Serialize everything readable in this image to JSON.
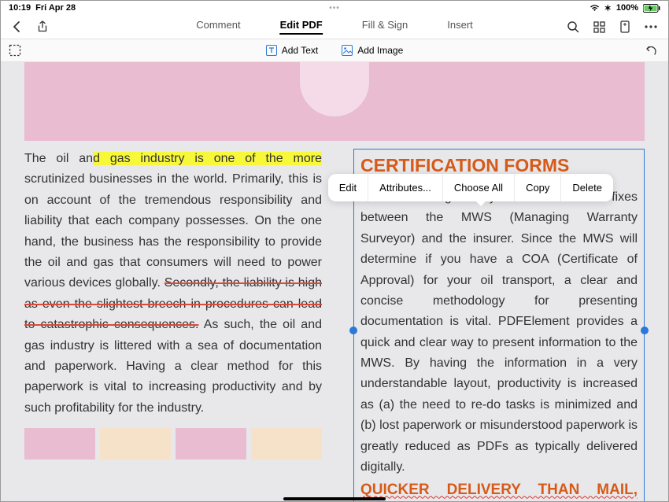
{
  "status": {
    "time": "10:19",
    "date": "Fri Apr 28",
    "battery": "100%"
  },
  "tabs": {
    "comment": "Comment",
    "edit": "Edit PDF",
    "fill": "Fill & Sign",
    "insert": "Insert"
  },
  "tools": {
    "addText": "Add Text",
    "addImage": "Add Image"
  },
  "contextMenu": [
    "Edit",
    "Attributes...",
    "Choose All",
    "Copy",
    "Delete"
  ],
  "leftCol": {
    "pre": "The oil an",
    "hl": "d gas industry is one of the more",
    "mid1": " scrutinized businesses in the world. Primarily, this is on account of the tremendous responsibility and liability that each company possesses. On the one hand, the business has the responsibility to provide the oil and gas that consumers will need to power various devices globally. ",
    "strike": "Secondly, the liability is high as even the slightest breech in procedures can lead to catastrophic consequences.",
    "mid2": " As such, the oil and gas industry is littered with a sea of documentation and paperwork. Having a clear method for this paperwork is vital to increasing productivity and by such profitability for the industry."
  },
  "rightCol": {
    "heading1": "CERTIFICATION FORMS",
    "body": "Certification is generally a back and forth of fixes between the MWS (Managing Warranty Surveyor) and the insurer. Since the MWS will determine if you have a COA (Certificate of Approval) for your oil transport, a clear and concise methodology for presenting documentation is vital. PDFElement provides a quick and clear way to present information to the MWS. By having the information in a very understandable layout, productivity is increased as (a) the need to re-do tasks is minimized and (b) lost paperwork or misunderstood paperwork is greatly reduced as PDFs as typically delivered digitally.",
    "heading2": "QUICKER DELIVERY THAN MAIL,"
  }
}
